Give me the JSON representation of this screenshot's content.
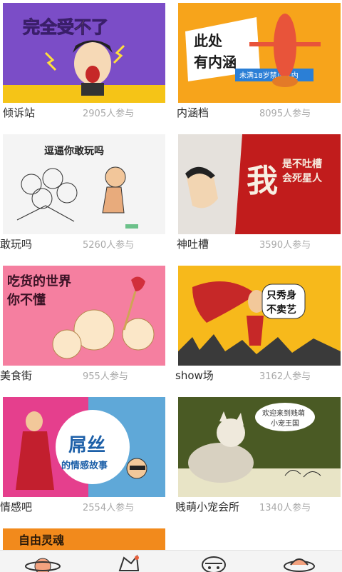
{
  "cards": [
    {
      "title": "倾诉站",
      "participants": "2905人参与",
      "image_text": [
        "完全受不了"
      ]
    },
    {
      "title": "内涵档",
      "participants": "8095人参与",
      "image_text": [
        "此处",
        "有内涵",
        "未满18岁禁止入内"
      ]
    },
    {
      "title": "敢玩吗",
      "participants": "5260人参与",
      "image_text": [
        "逗逼你敢玩吗"
      ]
    },
    {
      "title": "神吐槽",
      "participants": "3590人参与",
      "image_text": [
        "我",
        "是不吐槽",
        "会死星人"
      ]
    },
    {
      "title": "美食街",
      "participants": "955人参与",
      "image_text": [
        "吃货的世界",
        "你不懂"
      ]
    },
    {
      "title": "show场",
      "participants": "3162人参与",
      "image_text": [
        "只秀身",
        "不卖艺"
      ]
    },
    {
      "title": "情感吧",
      "participants": "2554人参与",
      "image_text": [
        "屌丝",
        "的情感故事"
      ]
    },
    {
      "title": "贱萌小宠会所",
      "participants": "1340人参与",
      "image_text": [
        "欢迎来到贱萌",
        "小宠王国"
      ]
    },
    {
      "title": "",
      "participants": "",
      "image_text": [
        "自由灵魂"
      ]
    }
  ],
  "tabs": [
    {
      "icon": "planet-icon"
    },
    {
      "icon": "star-doodle-icon"
    },
    {
      "icon": "face-icon"
    },
    {
      "icon": "ufo-icon"
    }
  ],
  "colors": {
    "label": "#2a2a2a",
    "count": "#a8a8a8",
    "tab_accent": "#e8603c"
  }
}
